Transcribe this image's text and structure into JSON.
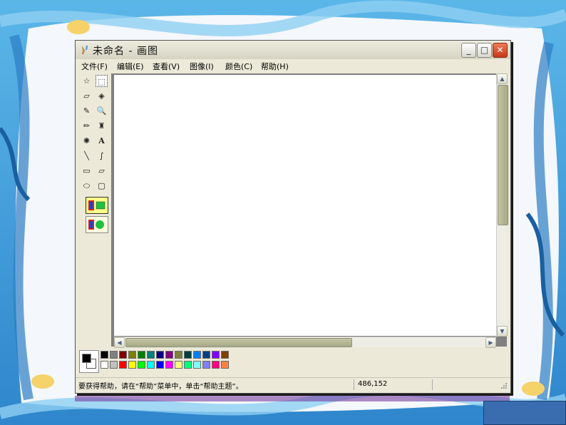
{
  "window": {
    "title": "未命名 - 画图",
    "minimize_glyph": "_",
    "maximize_glyph": "□",
    "close_glyph": "✕"
  },
  "menu": [
    {
      "label": "文件(F)"
    },
    {
      "label": "编辑(E)"
    },
    {
      "label": "查看(V)"
    },
    {
      "label": "图像(I)"
    },
    {
      "label": "颜色(C)"
    },
    {
      "label": "帮助(H)"
    }
  ],
  "tools": [
    {
      "name": "free-form-select",
      "glyph": "☆"
    },
    {
      "name": "rect-select",
      "glyph": "⬚"
    },
    {
      "name": "eraser",
      "glyph": "▱"
    },
    {
      "name": "fill",
      "glyph": "◈"
    },
    {
      "name": "pick-color",
      "glyph": "✎"
    },
    {
      "name": "magnifier",
      "glyph": "🔍"
    },
    {
      "name": "pencil",
      "glyph": "✏"
    },
    {
      "name": "brush",
      "glyph": "♜"
    },
    {
      "name": "airbrush",
      "glyph": "✺"
    },
    {
      "name": "text",
      "glyph": "A"
    },
    {
      "name": "line",
      "glyph": "╲"
    },
    {
      "name": "curve",
      "glyph": "∫"
    },
    {
      "name": "rectangle",
      "glyph": "▭"
    },
    {
      "name": "polygon",
      "glyph": "▱"
    },
    {
      "name": "ellipse",
      "glyph": "⬭"
    },
    {
      "name": "rounded-rect",
      "glyph": "▢"
    }
  ],
  "scroll_arrows": {
    "up": "▲",
    "down": "▼",
    "left": "◀",
    "right": "▶"
  },
  "palette": {
    "foreground": "#000000",
    "background": "#ffffff",
    "top_row": [
      "#000000",
      "#808080",
      "#800000",
      "#808000",
      "#008000",
      "#008080",
      "#000080",
      "#800080",
      "#808040",
      "#004040",
      "#0080ff",
      "#004080",
      "#8000ff",
      "#804000"
    ],
    "bottom_row": [
      "#ffffff",
      "#c0c0c0",
      "#ff0000",
      "#ffff00",
      "#00ff00",
      "#00ffff",
      "#0000ff",
      "#ff00ff",
      "#ffff80",
      "#00ff80",
      "#80ffff",
      "#8080ff",
      "#ff0080",
      "#ff8040"
    ]
  },
  "status": {
    "message": "要获得帮助，请在“帮助”菜单中，单击“帮助主题”。",
    "coords": "486,152"
  }
}
